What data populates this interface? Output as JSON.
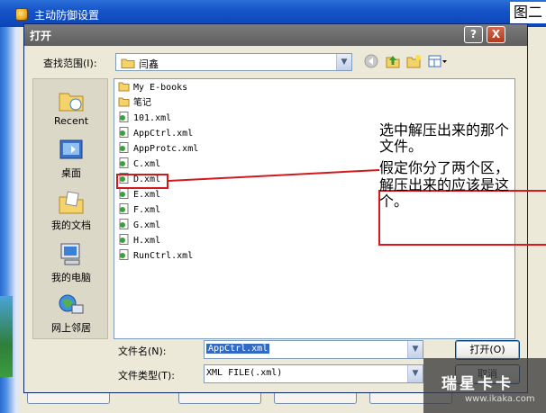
{
  "outer_window": {
    "title": "主动防御设置",
    "figure_tag": "图二"
  },
  "dialog": {
    "title": "打开",
    "help_btn": "?",
    "close_btn": "X",
    "lookin_label": "查找范围(I):",
    "lookin_value": "闫鑫",
    "nav_icons": [
      "back-icon",
      "up-folder-icon",
      "new-folder-icon",
      "view-menu-icon"
    ]
  },
  "places": [
    {
      "label": "Recent",
      "icon": "recent-icon"
    },
    {
      "label": "桌面",
      "icon": "desktop-icon"
    },
    {
      "label": "我的文档",
      "icon": "my-documents-icon"
    },
    {
      "label": "我的电脑",
      "icon": "my-computer-icon"
    },
    {
      "label": "网上邻居",
      "icon": "network-icon"
    }
  ],
  "files": [
    {
      "name": "My E-books",
      "type": "folder"
    },
    {
      "name": "笔记",
      "type": "folder"
    },
    {
      "name": "101.xml",
      "type": "xml"
    },
    {
      "name": "AppCtrl.xml",
      "type": "xml"
    },
    {
      "name": "AppProtc.xml",
      "type": "xml"
    },
    {
      "name": "C.xml",
      "type": "xml"
    },
    {
      "name": "D.xml",
      "type": "xml"
    },
    {
      "name": "E.xml",
      "type": "xml"
    },
    {
      "name": "F.xml",
      "type": "xml"
    },
    {
      "name": "G.xml",
      "type": "xml"
    },
    {
      "name": "H.xml",
      "type": "xml"
    },
    {
      "name": "RunCtrl.xml",
      "type": "xml"
    }
  ],
  "annotation": {
    "line1": "选中解压出来的那个",
    "line2": "文件。",
    "line3": "假定你分了两个区，",
    "line4": "解压出来的应该是这",
    "line5": "个。"
  },
  "filename": {
    "label": "文件名(N):",
    "value": "AppCtrl.xml"
  },
  "filetype": {
    "label": "文件类型(T):",
    "value": "XML FILE(.xml)"
  },
  "buttons": {
    "open": "打开(O)",
    "cancel": "取消"
  },
  "watermark": {
    "big": "瑞星卡卡",
    "small": "www.ikaka.com"
  },
  "colors": {
    "annotation_red": "#e0141b",
    "selection_blue": "#316ac5",
    "titlebar_grey": "#6a6a6a"
  }
}
